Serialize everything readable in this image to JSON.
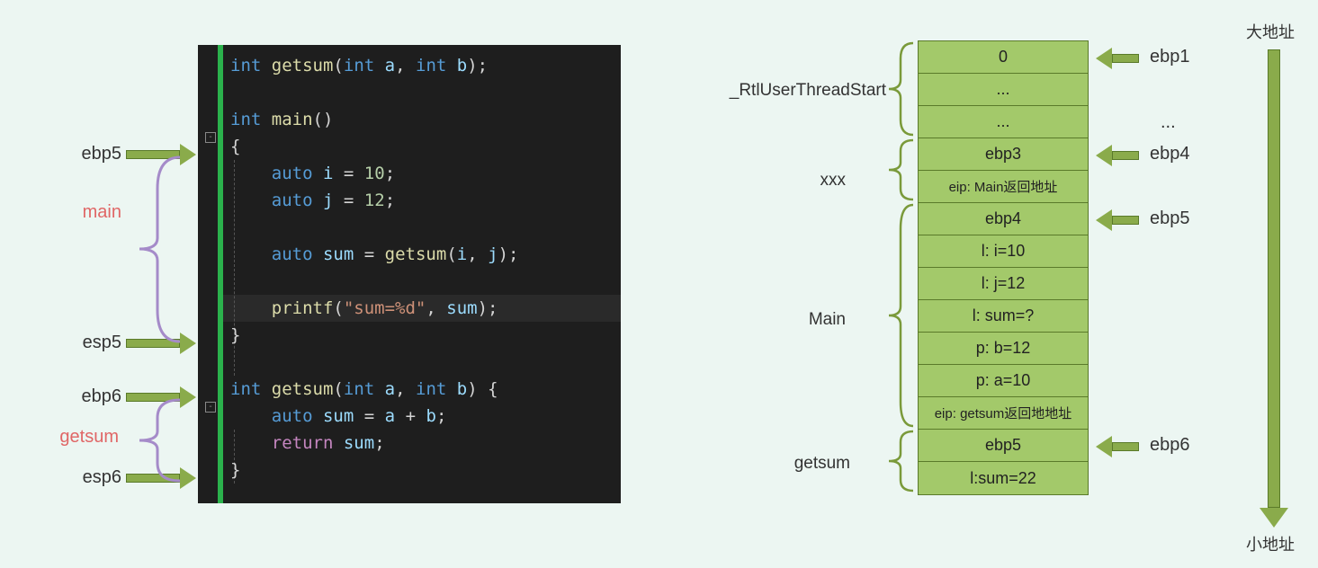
{
  "left_labels": {
    "ebp5": "ebp5",
    "main": "main",
    "esp5": "esp5",
    "ebp6": "ebp6",
    "getsum": "getsum",
    "esp6": "esp6"
  },
  "code": {
    "decl": "int getsum(int a, int b);",
    "main_sig": "int main()",
    "open_brace": "{",
    "i_line": "    auto i = 10;",
    "j_line": "    auto j = 12;",
    "sum_line": "    auto sum = getsum(i, j);",
    "printf_line": "    printf(\"sum=%d\", sum);",
    "close_brace": "}",
    "getsum_sig": "int getsum(int a, int b) {",
    "getsum_body": "    auto sum = a + b;",
    "getsum_ret": "    return sum;",
    "getsum_close": "}"
  },
  "stack": [
    "0",
    "...",
    "...",
    "ebp3",
    "eip: Main返回地址",
    "ebp4",
    "l: i=10",
    "l: j=12",
    "l: sum=?",
    "p: b=12",
    "p: a=10",
    "eip: getsum返回地地址",
    "ebp5",
    "l:sum=22"
  ],
  "stack_groups": {
    "rtl": "_RtlUserThreadStart",
    "xxx": "xxx",
    "main": "Main",
    "getsum": "getsum"
  },
  "pointers": {
    "ebp1": "ebp1",
    "dots": "...",
    "ebp4": "ebp4",
    "ebp5": "ebp5",
    "ebp6": "ebp6"
  },
  "addr": {
    "high": "大地址",
    "low": "小地址"
  }
}
